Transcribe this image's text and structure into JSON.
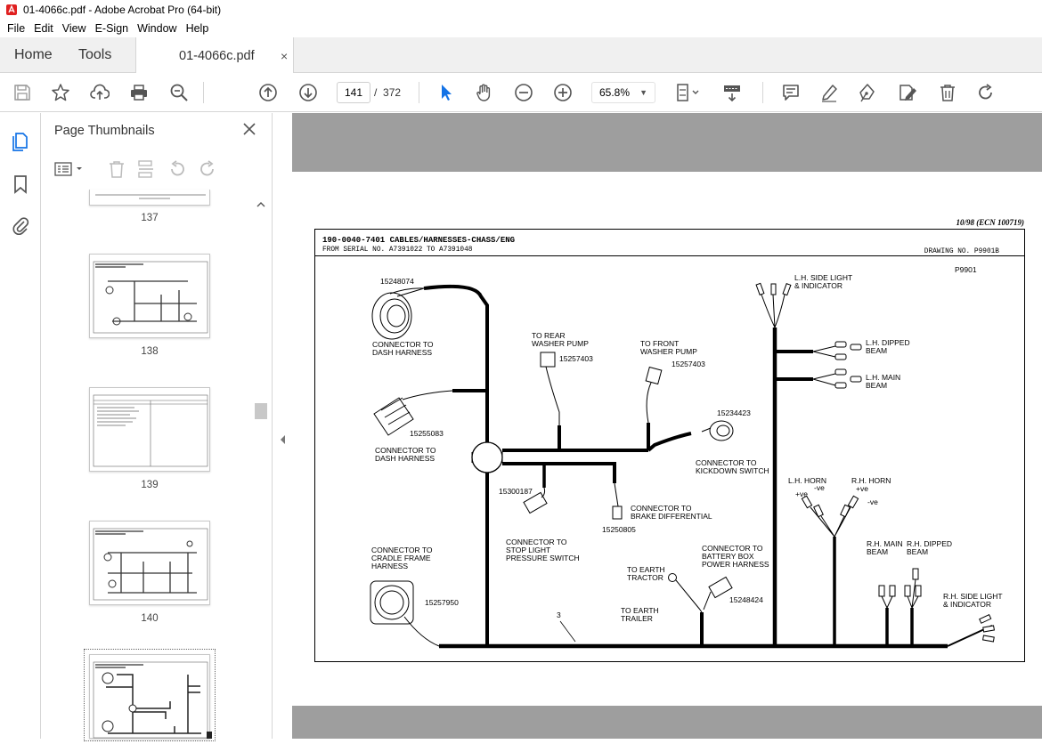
{
  "window": {
    "title": "01-4066c.pdf - Adobe Acrobat Pro (64-bit)"
  },
  "menu": [
    "File",
    "Edit",
    "View",
    "E-Sign",
    "Window",
    "Help"
  ],
  "tabs": {
    "home": "Home",
    "tools": "Tools",
    "document": "01-4066c.pdf",
    "close": "×"
  },
  "toolbar": {
    "current_page": "141",
    "page_separator": "/",
    "total_pages": "372",
    "zoom": "65.8%"
  },
  "thumbnails": {
    "title": "Page Thumbnails",
    "pages": [
      {
        "label": "137"
      },
      {
        "label": "138"
      },
      {
        "label": "139"
      },
      {
        "label": "140"
      },
      {
        "label": "141",
        "selected": true
      }
    ]
  },
  "document": {
    "ecn": "10/98 (ECN 100719)",
    "header_title": "190-0040-7401  CABLES/HARNESSES-CHASS/ENG",
    "header_serial": "FROM SERIAL NO. A7391022 TO A7391048",
    "drawing_no": "DRAWING NO. P9901B",
    "ref": "P9901",
    "labels": {
      "c1_part": "15248074",
      "c1_name_1": "CONNECTOR TO",
      "c1_name_2": "DASH HARNESS",
      "c2_part": "15255083",
      "c2_name_1": "CONNECTOR TO",
      "c2_name_2": "DASH HARNESS",
      "rear_1": "TO REAR",
      "rear_2": "WASHER PUMP",
      "rear_part": "15257403",
      "front_1": "TO FRONT",
      "front_2": "WASHER PUMP",
      "front_part": "15257403",
      "kick_part": "15234423",
      "kick_1": "CONNECTOR TO",
      "kick_2": "KICKDOWN SWITCH",
      "stop_part": "15300187",
      "stop_1": "CONNECTOR TO",
      "stop_2": "STOP LIGHT",
      "stop_3": "PRESSURE SWITCH",
      "brake_1": "CONNECTOR TO",
      "brake_2": "BRAKE DIFFERENTIAL",
      "brake_part": "15250805",
      "cradle_1": "CONNECTOR TO",
      "cradle_2": "CRADLE FRAME",
      "cradle_3": "HARNESS",
      "cradle_part": "15257950",
      "earth_tractor_1": "TO EARTH",
      "earth_tractor_2": "TRACTOR",
      "earth_trailer_1": "TO EARTH",
      "earth_trailer_2": "TRAILER",
      "battery_1": "CONNECTOR TO",
      "battery_2": "BATTERY BOX",
      "battery_3": "POWER HARNESS",
      "battery_part": "15248424",
      "item3": "3",
      "lh_side_1": "L.H. SIDE LIGHT",
      "lh_side_2": "& INDICATOR",
      "lh_dip_1": "L.H. DIPPED",
      "lh_dip_2": "BEAM",
      "lh_main_1": "L.H. MAIN",
      "lh_main_2": "BEAM",
      "lh_horn": "L.H. HORN",
      "rh_horn": "R.H. HORN",
      "plus_ve": "+ve",
      "minus_ve": "-ve",
      "rh_main_1": "R.H. MAIN",
      "rh_main_2": "BEAM",
      "rh_dip_1": "R.H. DIPPED",
      "rh_dip_2": "BEAM",
      "rh_side_1": "R.H. SIDE LIGHT",
      "rh_side_2": "& INDICATOR"
    }
  },
  "colors": {
    "accent_blue": "#1473e6",
    "pdf_icon_red": "#e02020",
    "viewer_bg": "#9e9e9e"
  }
}
